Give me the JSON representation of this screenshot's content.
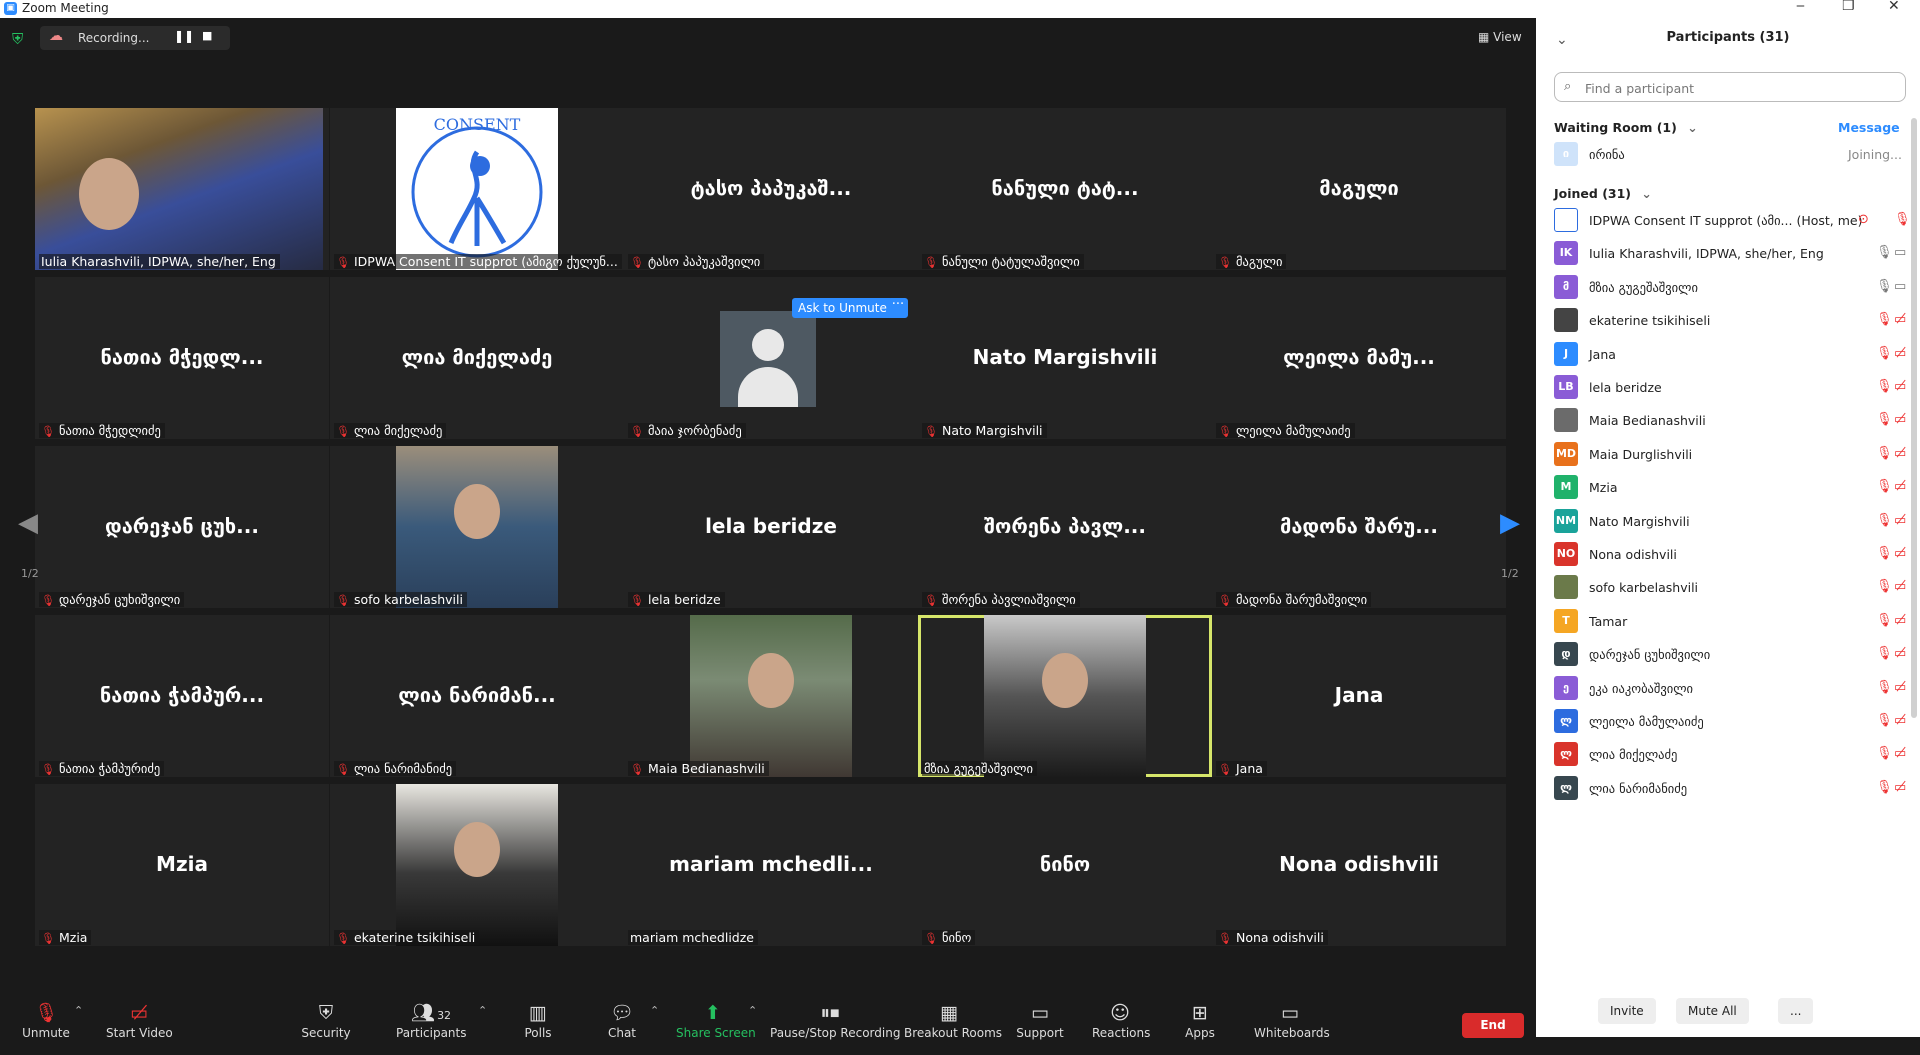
{
  "window": {
    "title": "Zoom Meeting",
    "min": "‒",
    "restore": "❐",
    "close": "✕"
  },
  "topbar": {
    "recording": "Recording...",
    "pause": "❚❚",
    "stop": "■",
    "view": "View"
  },
  "grid": {
    "page": "1/2",
    "tiles": [
      {
        "name": "",
        "label": "Iulia Kharashvili, IDPWA, she/her, Eng"
      },
      {
        "name": "",
        "label": "IDPWA Consent IT supprot (ამიგო ქულუნ..."
      },
      {
        "name": "ტასო პაპუკაშ...",
        "label": "ტასო პაპუკაშვილი"
      },
      {
        "name": "ნანული ტატ...",
        "label": "ნანული ტატულაშვილი"
      },
      {
        "name": "მაგული",
        "label": "მაგული"
      },
      {
        "name": "ნათია მჭედლ...",
        "label": "ნათია მჭედლიძე"
      },
      {
        "name": "ლია მიქელაძე",
        "label": "ლია მიქელაძე"
      },
      {
        "name": "",
        "label": "მაია ჯორბენაძე"
      },
      {
        "name": "Nato Margishvili",
        "label": "Nato Margishvili"
      },
      {
        "name": "ლეილა მამუ...",
        "label": "ლეილა მამულაიძე"
      },
      {
        "name": "დარეჯან ცუხ...",
        "label": "დარეჯან ცუხიშვილი"
      },
      {
        "name": "",
        "label": "sofo karbelashvili"
      },
      {
        "name": "lela beridze",
        "label": "lela beridze"
      },
      {
        "name": "შორენა პავლ...",
        "label": "შორენა პავლიაშვილი"
      },
      {
        "name": "მადონა შარუ...",
        "label": "მადონა შარუმაშვილი"
      },
      {
        "name": "ნათია ჭამპურ...",
        "label": "ნათია ჭამპურიძე"
      },
      {
        "name": "ლია ნარიმან...",
        "label": "ლია ნარიმანიძე"
      },
      {
        "name": "",
        "label": "Maia Bedianashvili"
      },
      {
        "name": "",
        "label": "მზია გუგეშაშვილი"
      },
      {
        "name": "Jana",
        "label": "Jana"
      },
      {
        "name": "Mzia",
        "label": "Mzia"
      },
      {
        "name": "",
        "label": "ekaterine tsikihiseli"
      },
      {
        "name": "mariam mchedli...",
        "label": "mariam mchedlidze"
      },
      {
        "name": "ნინო",
        "label": "ნინო"
      },
      {
        "name": "Nona odishvili",
        "label": "Nona odishvili"
      }
    ],
    "ask_unmute": "Ask to Unmute",
    "ask_more": "···",
    "logo_text": "CONSENT"
  },
  "toolbar": {
    "unmute": "Unmute",
    "start_video": "Start Video",
    "security": "Security",
    "participants": "Participants",
    "participants_count": "32",
    "polls": "Polls",
    "chat": "Chat",
    "share_screen": "Share Screen",
    "pause_stop": "Pause/Stop Recording",
    "breakout": "Breakout Rooms",
    "support": "Support",
    "reactions": "Reactions",
    "apps": "Apps",
    "whiteboards": "Whiteboards",
    "end": "End"
  },
  "panel": {
    "title": "Participants (31)",
    "search_placeholder": "Find a participant",
    "waiting_label": "Waiting Room (1)",
    "message": "Message",
    "waiting": {
      "initial": "ი",
      "name": "ირინა",
      "status": "Joining..."
    },
    "joined_label": "Joined (31)",
    "participants": [
      {
        "initials": "",
        "name": "IDPWA Consent IT supprot (ამი... (Host, me)",
        "color": "#ffffff",
        "icons": "rec"
      },
      {
        "initials": "IK",
        "name": "Iulia Kharashvili, IDPWA, she/her, Eng",
        "color": "#8a5cd6",
        "icons": "gray"
      },
      {
        "initials": "მ",
        "name": "მზია გუგეშაშვილი",
        "color": "#8a5cd6",
        "icons": "gray"
      },
      {
        "initials": "",
        "name": "ekaterine tsikihiseli",
        "color": "#444444",
        "icons": "red"
      },
      {
        "initials": "J",
        "name": "Jana",
        "color": "#2d8cff",
        "icons": "red"
      },
      {
        "initials": "LB",
        "name": "lela beridze",
        "color": "#8a5cd6",
        "icons": "red"
      },
      {
        "initials": "",
        "name": "Maia Bedianashvili",
        "color": "#6b6b6b",
        "icons": "red"
      },
      {
        "initials": "MD",
        "name": "Maia Durglishvili",
        "color": "#e8711c",
        "icons": "red"
      },
      {
        "initials": "M",
        "name": "Mzia",
        "color": "#20b26b",
        "icons": "red"
      },
      {
        "initials": "NM",
        "name": "Nato Margishvili",
        "color": "#1aa39a",
        "icons": "red"
      },
      {
        "initials": "NO",
        "name": "Nona odishvili",
        "color": "#d9342b",
        "icons": "red"
      },
      {
        "initials": "",
        "name": "sofo karbelashvili",
        "color": "#6b7a4a",
        "icons": "red"
      },
      {
        "initials": "T",
        "name": "Tamar",
        "color": "#f5a623",
        "icons": "red"
      },
      {
        "initials": "დ",
        "name": "დარეჯან ცუხიშვილი",
        "color": "#37474f",
        "icons": "red"
      },
      {
        "initials": "ე",
        "name": "ეკა იაკობაშვილი",
        "color": "#8a5cd6",
        "icons": "red"
      },
      {
        "initials": "ლ",
        "name": "ლეილა მამულაიძე",
        "color": "#2d6cdf",
        "icons": "red"
      },
      {
        "initials": "ლ",
        "name": "ლია მიქელაძე",
        "color": "#d9342b",
        "icons": "red"
      },
      {
        "initials": "ლ",
        "name": "ლია ნარიმანიძე",
        "color": "#37474f",
        "icons": "red"
      }
    ],
    "invite": "Invite",
    "mute_all": "Mute All",
    "more": "..."
  }
}
